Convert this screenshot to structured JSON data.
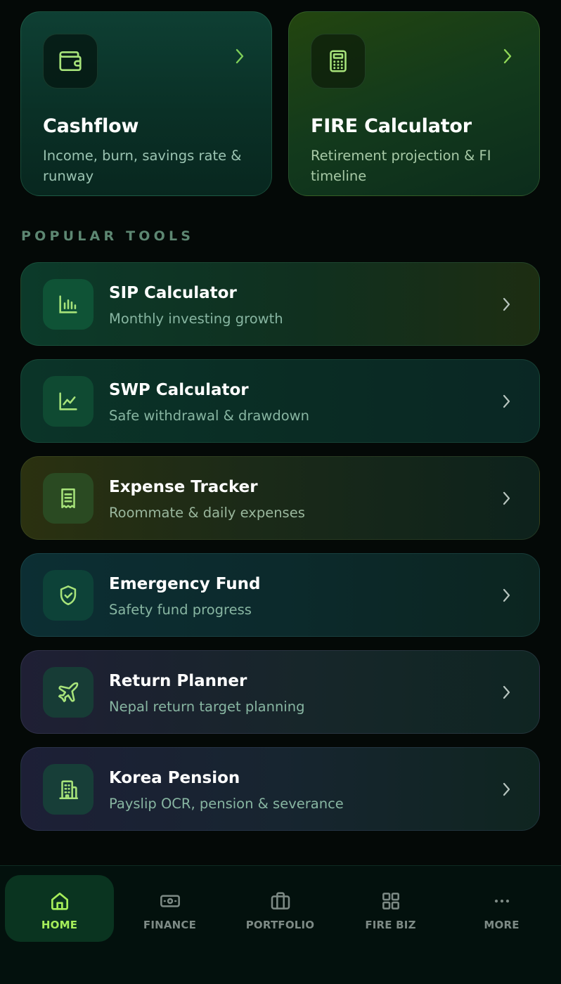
{
  "colors": {
    "accent_green": "#a6ee5a",
    "icon_green": "#a7e37a",
    "muted_text": "#88b6a2",
    "background": "#040907"
  },
  "quick_cards": [
    {
      "title": "Cashflow",
      "description": "Income, burn, savings rate & runway",
      "icon": "wallet-icon"
    },
    {
      "title": "FIRE Calculator",
      "description": "Retirement projection & FI timeline",
      "icon": "calculator-icon"
    }
  ],
  "section": {
    "heading": "POPULAR TOOLS"
  },
  "tools": [
    {
      "title": "SIP Calculator",
      "subtitle": "Monthly investing growth",
      "icon": "bar-chart-icon"
    },
    {
      "title": "SWP Calculator",
      "subtitle": "Safe withdrawal & drawdown",
      "icon": "line-chart-icon"
    },
    {
      "title": "Expense Tracker",
      "subtitle": "Roommate & daily expenses",
      "icon": "receipt-icon"
    },
    {
      "title": "Emergency Fund",
      "subtitle": "Safety fund progress",
      "icon": "shield-check-icon"
    },
    {
      "title": "Return Planner",
      "subtitle": "Nepal return target planning",
      "icon": "plane-icon"
    },
    {
      "title": "Korea Pension",
      "subtitle": "Payslip OCR, pension & severance",
      "icon": "building-icon"
    }
  ],
  "nav": [
    {
      "label": "HOME",
      "icon": "home-icon",
      "active": true
    },
    {
      "label": "FINANCE",
      "icon": "banknote-icon",
      "active": false
    },
    {
      "label": "PORTFOLIO",
      "icon": "briefcase-icon",
      "active": false
    },
    {
      "label": "FIRE BIZ",
      "icon": "grid-icon",
      "active": false
    },
    {
      "label": "MORE",
      "icon": "more-dots-icon",
      "active": false
    }
  ]
}
